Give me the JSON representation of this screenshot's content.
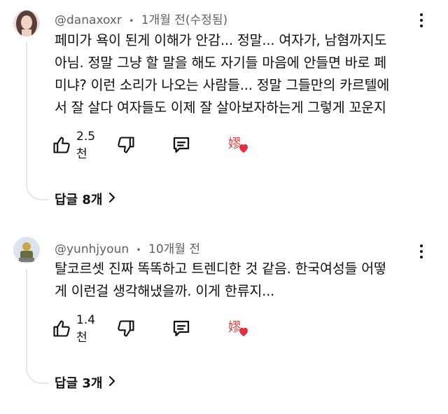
{
  "comments": [
    {
      "author": "@danaxoxr",
      "separator": "•",
      "time": "1개월 전(수정됨)",
      "text": "페미가 욕이 된게 이해가 안감... 정말... 여자가, 남혐까지도\n아님. 정말 그냥 할 말을 해도 자기들 마음에 안들면 바로 페\n미냐? 이런 소리가 나오는 사람들... 정말 그들만의 카르텔에\n서 잘 살다 여자들도 이제 잘 살아보자하는게 그렇게 꼬운지",
      "likes": "2.5천",
      "creator_heart_glyph": "嫪",
      "replies": "답글 8개",
      "replies_chevron": ">"
    },
    {
      "author": "@yunhjyoun",
      "separator": "•",
      "time": "10개월 전",
      "text": "탈코르셋 진짜 똑똑하고 트렌디한 것 같음. 한국여성들 어떻\n게 이런걸 생각해냈을까. 이게 한류지...",
      "likes": "1.4천",
      "creator_heart_glyph": "嫪",
      "replies": "답글 3개",
      "replies_chevron": ">"
    }
  ],
  "colors": {
    "text": "#0f0f0f",
    "meta": "#606060",
    "heart": "#e0323c",
    "line": "#e6e6e6"
  },
  "icons": [
    "like-icon",
    "dislike-icon",
    "reply-icon",
    "heart-icon",
    "more-vert-icon",
    "chevron-right-icon"
  ]
}
